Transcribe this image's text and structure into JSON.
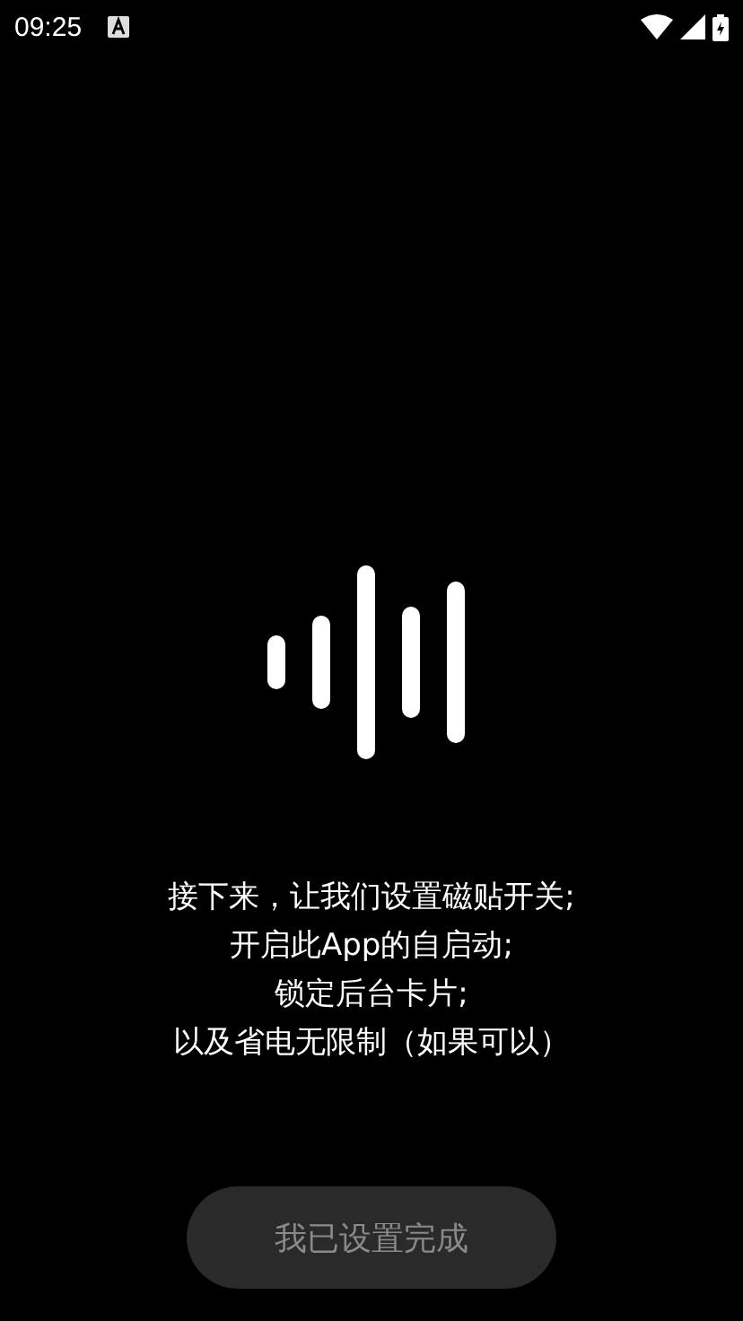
{
  "status_bar": {
    "time": "09:25"
  },
  "message": [
    "接下来，让我们设置磁贴开关;",
    "开启此App的自启动;",
    "锁定后台卡片;",
    "以及省电无限制（如果可以）"
  ],
  "button": {
    "label": "我已设置完成",
    "disabled": true
  }
}
